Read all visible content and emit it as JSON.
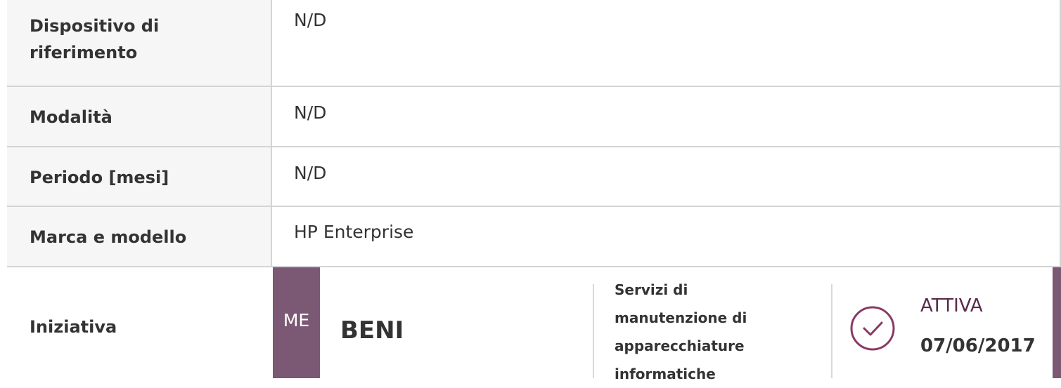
{
  "rows": [
    {
      "label": "Dispositivo di riferimento",
      "value": "N/D"
    },
    {
      "label": "Modalità",
      "value": "N/D"
    },
    {
      "label": "Periodo [mesi]",
      "value": "N/D"
    },
    {
      "label": "Marca e modello",
      "value": "HP Enterprise"
    }
  ],
  "initiative": {
    "label": "Iniziativa",
    "badge": "ME",
    "title": "BENI",
    "description": "Servizi di manutenzione di apparecchiature informatiche",
    "status": "ATTIVA",
    "date": "07/06/2017",
    "status_icon": "check-circle-icon",
    "accent_color": "#7b5873"
  }
}
